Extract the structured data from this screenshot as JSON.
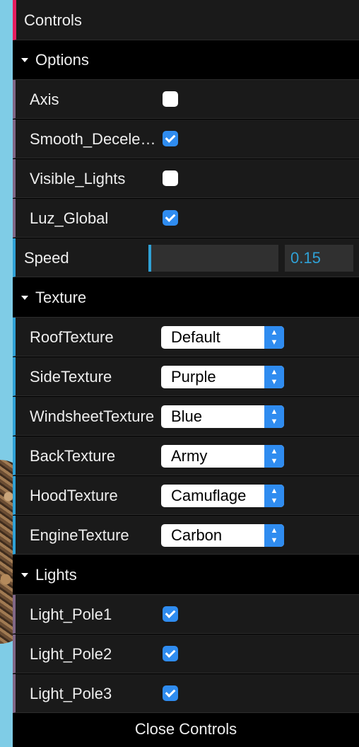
{
  "title": "Controls",
  "options": {
    "folder": "Options",
    "items": [
      {
        "label": "Axis",
        "checked": false
      },
      {
        "label": "Smooth_Deceleration",
        "checked": true
      },
      {
        "label": "Visible_Lights",
        "checked": false
      },
      {
        "label": "Luz_Global",
        "checked": true
      }
    ]
  },
  "speed": {
    "label": "Speed",
    "value": "0.15",
    "fraction": 0.0
  },
  "texture": {
    "folder": "Texture",
    "items": [
      {
        "label": "RoofTexture",
        "value": "Default"
      },
      {
        "label": "SideTexture",
        "value": "Purple"
      },
      {
        "label": "WindsheetTexture",
        "value": "Blue"
      },
      {
        "label": "BackTexture",
        "value": "Army"
      },
      {
        "label": "HoodTexture",
        "value": "Camuflage"
      },
      {
        "label": "EngineTexture",
        "value": "Carbon"
      }
    ]
  },
  "lights": {
    "folder": "Lights",
    "items": [
      {
        "label": "Light_Pole1",
        "checked": true
      },
      {
        "label": "Light_Pole2",
        "checked": true
      },
      {
        "label": "Light_Pole3",
        "checked": true
      }
    ]
  },
  "close_label": "Close Controls",
  "icons": {
    "expanded": "triangle-down-icon",
    "select": "updown-chevron-icon"
  },
  "colors": {
    "accent": "#2fa1d6",
    "bool": "#806787",
    "title": "#e61d5f",
    "check": "#2f8cf0"
  }
}
